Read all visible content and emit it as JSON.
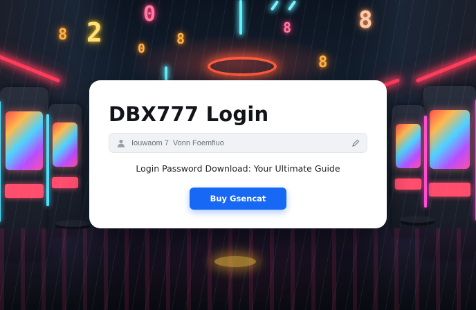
{
  "login_card": {
    "title": "DBX777 Login",
    "username_placeholder": "Iouwaom 7  Vonn Foemfiuo",
    "subtitle": "Login Password Download: Your Ultimate Guide",
    "button_label": "Buy Gsencat"
  },
  "background": {
    "neon_digits": [
      "0",
      "2",
      "8",
      "8",
      "0",
      "8",
      "8",
      "8"
    ],
    "accent_colors": {
      "primary_button": "#1769f5",
      "neon_pink": "#ff3b5c",
      "neon_cyan": "#5ff3ff",
      "neon_orange": "#ffb347"
    }
  },
  "icons": {
    "username_field_left": "user-icon",
    "username_field_right": "pen-icon"
  }
}
